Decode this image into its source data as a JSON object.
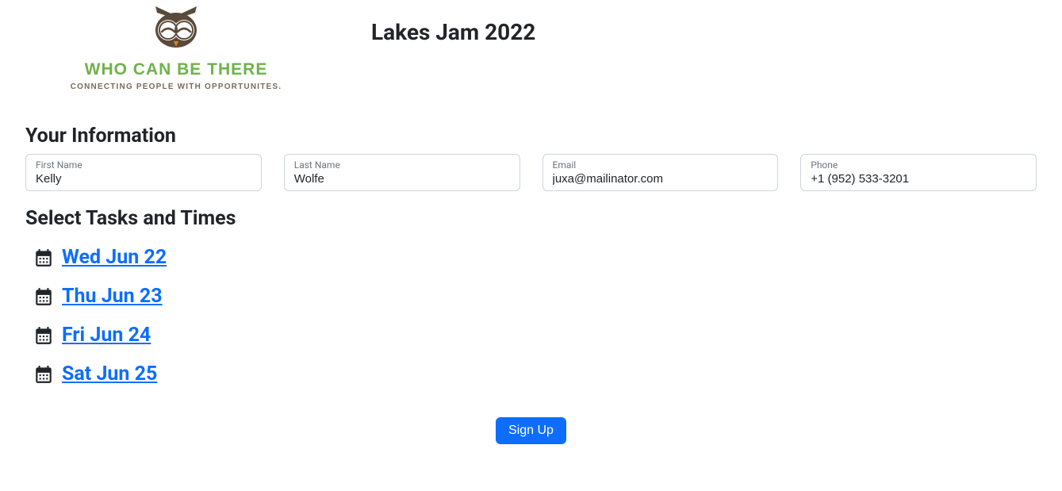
{
  "logo": {
    "main_text": "WHO CAN BE THERE",
    "tagline": "CONNECTING PEOPLE WITH OPPORTUNITES."
  },
  "page_title": "Lakes Jam 2022",
  "sections": {
    "your_info_title": "Your Information",
    "select_tasks_title": "Select Tasks and Times"
  },
  "form": {
    "first_name": {
      "label": "First Name",
      "value": "Kelly"
    },
    "last_name": {
      "label": "Last Name",
      "value": "Wolfe"
    },
    "email": {
      "label": "Email",
      "value": "juxa@mailinator.com"
    },
    "phone": {
      "label": "Phone",
      "value": "+1 (952) 533-3201"
    }
  },
  "dates": [
    {
      "label": "Wed Jun 22"
    },
    {
      "label": "Thu Jun 23"
    },
    {
      "label": "Fri Jun 24"
    },
    {
      "label": "Sat Jun 25"
    }
  ],
  "signup_button": "Sign Up"
}
